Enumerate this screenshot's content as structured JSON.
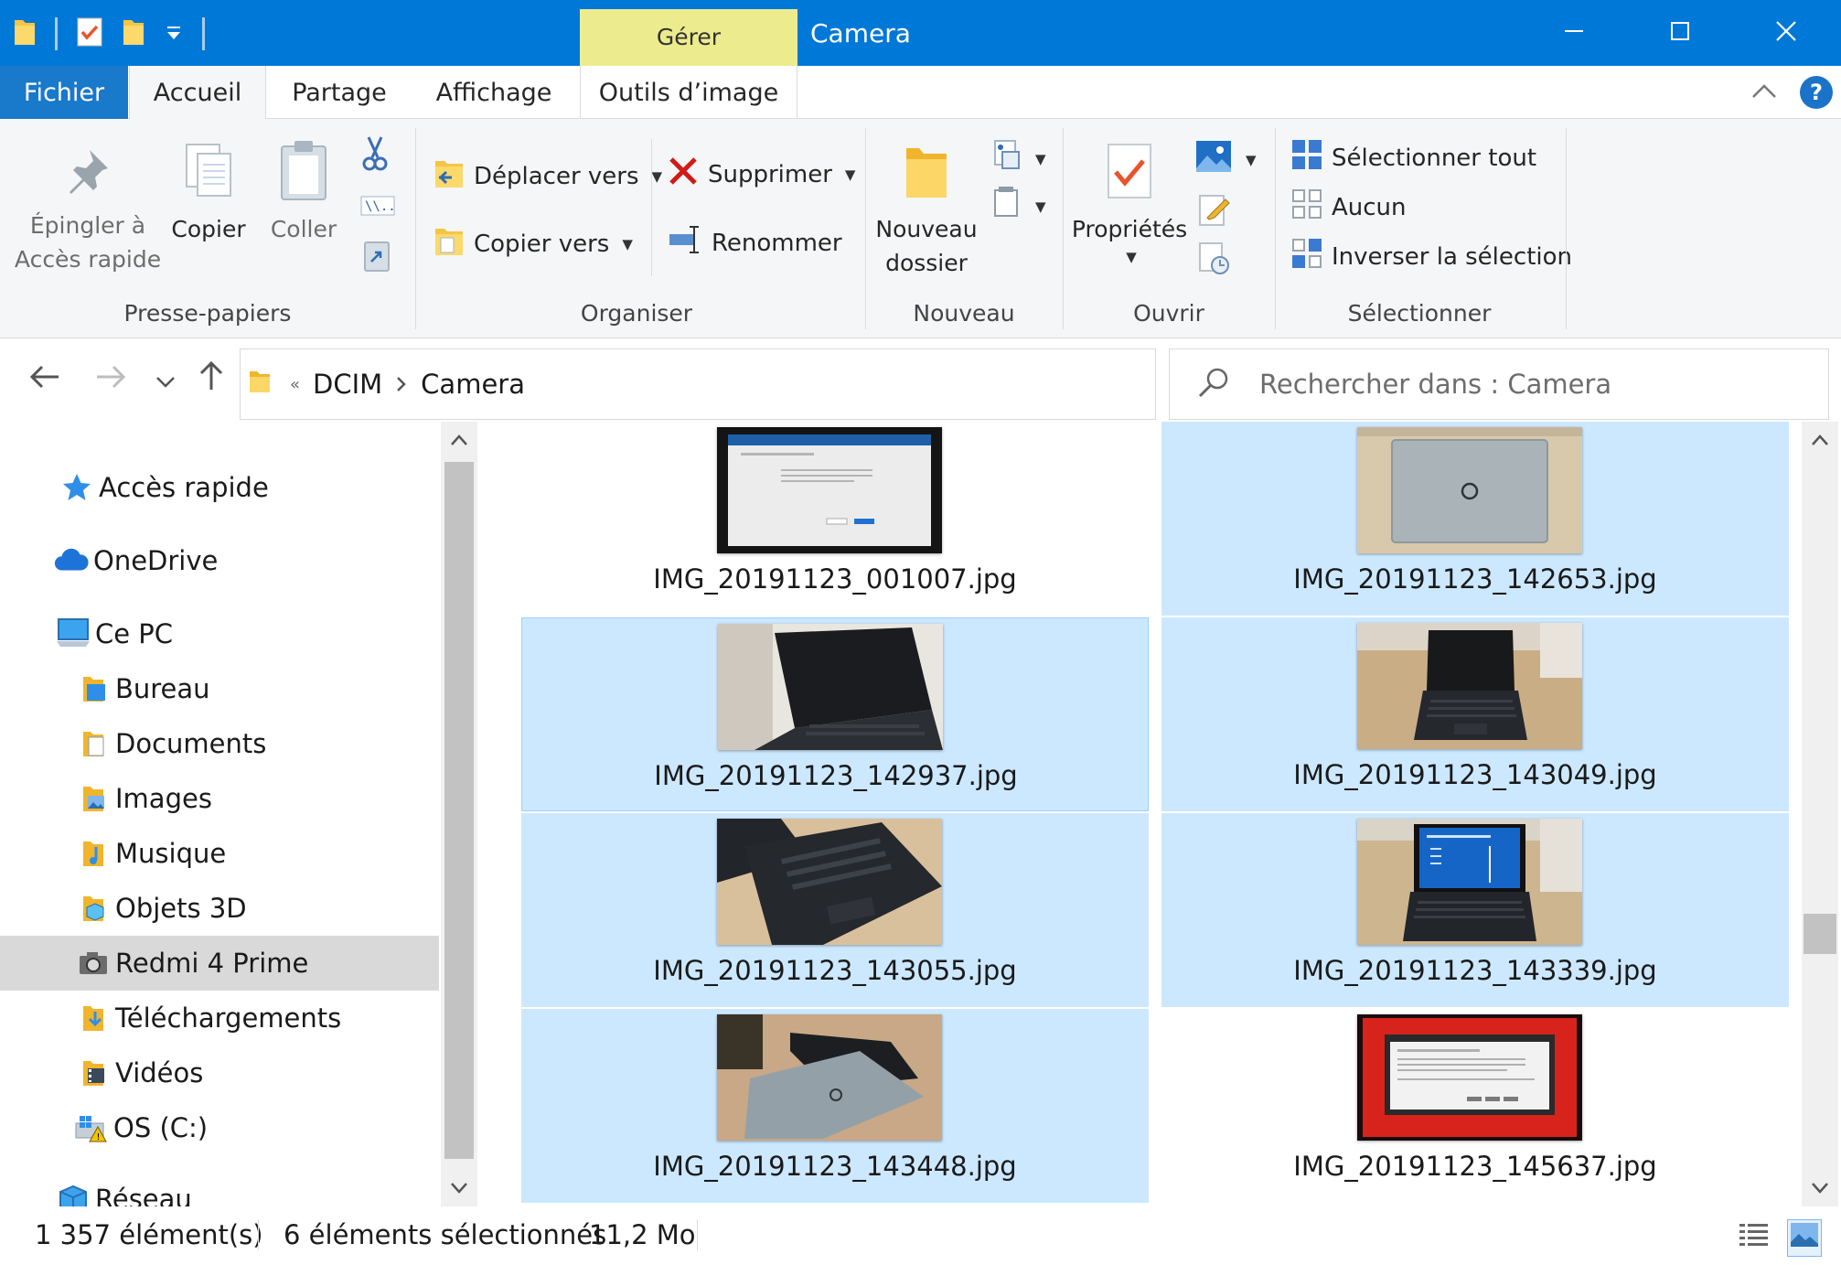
{
  "titlebar": {
    "context_tab": "Gérer",
    "title": "Camera",
    "minimize_icon": "minimize-icon",
    "maximize_icon": "maximize-icon",
    "close_icon": "close-icon"
  },
  "tabs": {
    "fichier": "Fichier",
    "accueil": "Accueil",
    "partage": "Partage",
    "affichage": "Affichage",
    "outils": "Outils d’image",
    "help": "?"
  },
  "ribbon": {
    "presse_papiers": {
      "label": "Presse-papiers",
      "pin_line1": "Épingler à",
      "pin_line2": "Accès rapide",
      "copy": "Copier",
      "paste": "Coller"
    },
    "organiser": {
      "label": "Organiser",
      "move_to": "Déplacer vers",
      "copy_to": "Copier vers",
      "delete": "Supprimer",
      "rename": "Renommer"
    },
    "nouveau": {
      "label": "Nouveau",
      "new_folder_line1": "Nouveau",
      "new_folder_line2": "dossier"
    },
    "ouvrir": {
      "label": "Ouvrir",
      "properties": "Propriétés"
    },
    "selectionner": {
      "label": "Sélectionner",
      "select_all": "Sélectionner tout",
      "none": "Aucun",
      "invert": "Inverser la sélection"
    }
  },
  "address": {
    "overflow": "«",
    "crumb1": "DCIM",
    "crumb2": "Camera",
    "search_placeholder": "Rechercher dans : Camera"
  },
  "nav": {
    "quick_access": "Accès rapide",
    "onedrive": "OneDrive",
    "this_pc": "Ce PC",
    "bureau": "Bureau",
    "documents": "Documents",
    "images": "Images",
    "musique": "Musique",
    "objets3d": "Objets 3D",
    "redmi": "Redmi 4 Prime",
    "telechargements": "Téléchargements",
    "videos": "Vidéos",
    "os": "OS (C:)",
    "reseau": "Réseau"
  },
  "files": [
    {
      "name": "IMG_20191123_001007.jpg",
      "selected": false
    },
    {
      "name": "IMG_20191123_142653.jpg",
      "selected": true
    },
    {
      "name": "IMG_20191123_142937.jpg",
      "selected": true
    },
    {
      "name": "IMG_20191123_143049.jpg",
      "selected": true
    },
    {
      "name": "IMG_20191123_143055.jpg",
      "selected": true
    },
    {
      "name": "IMG_20191123_143339.jpg",
      "selected": true
    },
    {
      "name": "IMG_20191123_143448.jpg",
      "selected": true
    },
    {
      "name": "IMG_20191123_145637.jpg",
      "selected": false
    }
  ],
  "status": {
    "count": "1 357 élément(s)",
    "selected": "6 éléments sélectionnés",
    "size": "11,2 Mo"
  },
  "colors": {
    "titlebar": "#0078d7",
    "context_tab": "#ecec8e",
    "selection": "#cce8ff"
  }
}
